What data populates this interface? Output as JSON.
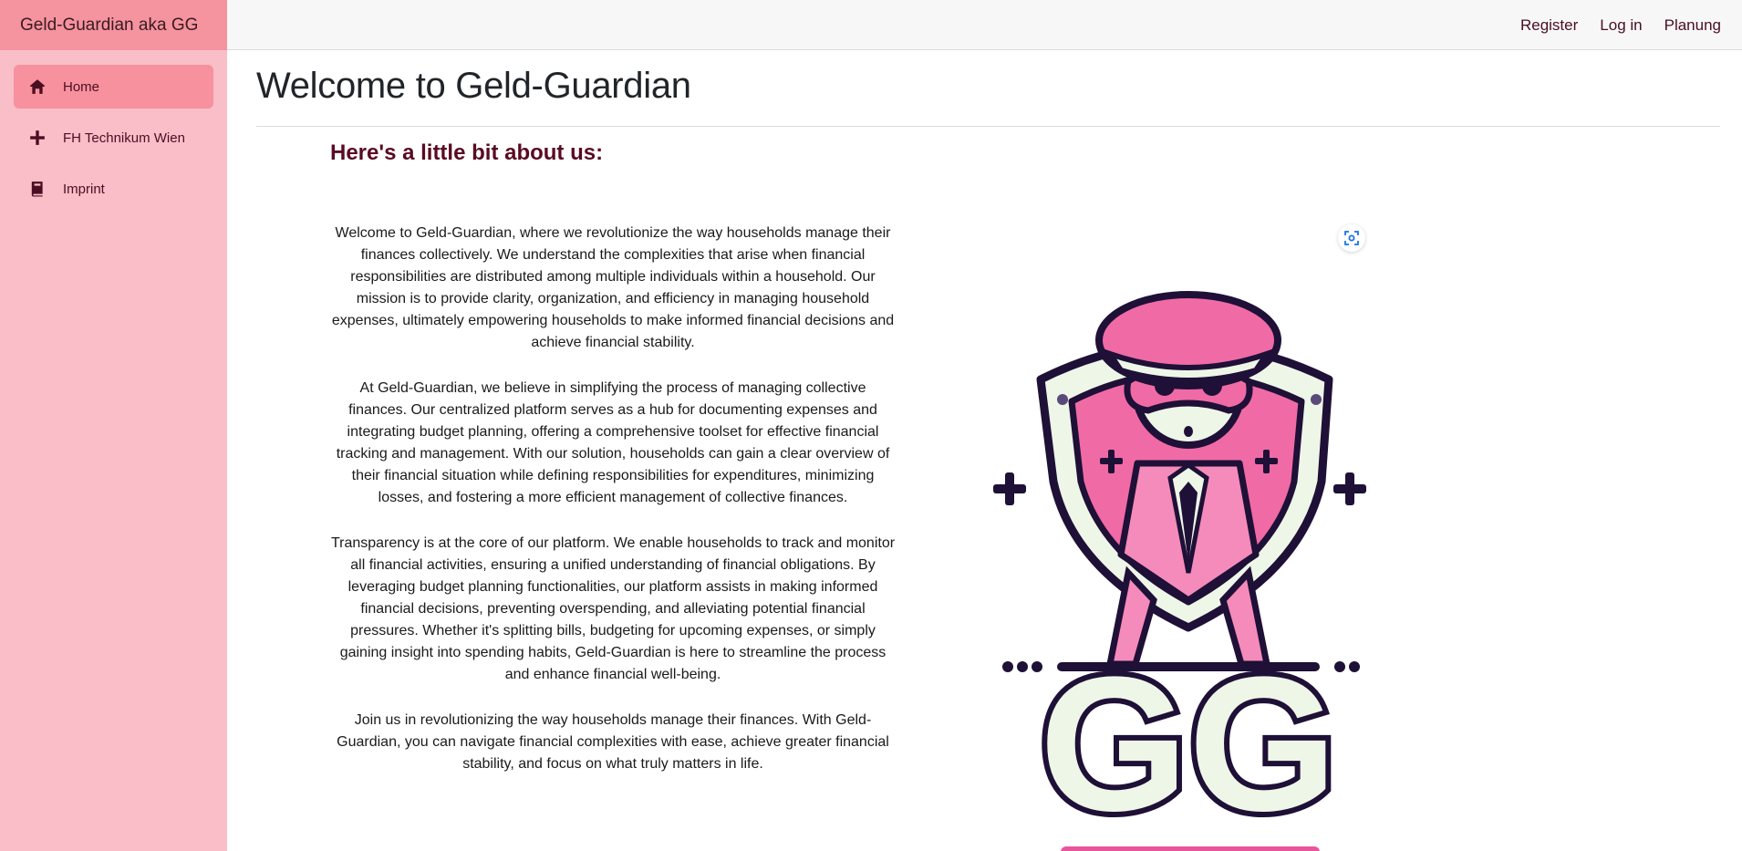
{
  "brand": {
    "title": "Geld-Guardian aka GG"
  },
  "sidebar": {
    "items": [
      {
        "label": "Home",
        "icon": "home-icon",
        "active": true
      },
      {
        "label": "FH Technikum Wien",
        "icon": "plus-icon",
        "active": false
      },
      {
        "label": "Imprint",
        "icon": "book-icon",
        "active": false
      }
    ]
  },
  "topnav": {
    "register": "Register",
    "login": "Log in",
    "planung": "Planung"
  },
  "main": {
    "title": "Welcome to Geld-Guardian",
    "subheading": "Here's a little bit about us:",
    "paragraphs": [
      "Welcome to Geld-Guardian, where we revolutionize the way households manage their finances collectively. We understand the complexities that arise when financial responsibilities are distributed among multiple individuals within a household. Our mission is to provide clarity, organization, and efficiency in managing household expenses, ultimately empowering households to make informed financial decisions and achieve financial stability.",
      "At Geld-Guardian, we believe in simplifying the process of managing collective finances. Our centralized platform serves as a hub for documenting expenses and integrating budget planning, offering a comprehensive toolset for effective financial tracking and management. With our solution, households can gain a clear overview of their financial situation while defining responsibilities for expenditures, minimizing losses, and fostering a more efficient management of collective finances.",
      "Transparency is at the core of our platform. We enable households to track and monitor all financial activities, ensuring a unified understanding of financial obligations. By leveraging budget planning functionalities, our platform assists in making informed financial decisions, preventing overspending, and alleviating potential financial pressures. Whether it's splitting bills, budgeting for upcoming expenses, or simply gaining insight into spending habits, Geld-Guardian is here to streamline the process and enhance financial well-being.",
      "Join us in revolutionizing the way households manage their finances. With Geld-Guardian, you can navigate financial complexities with ease, achieve greater financial stability, and focus on what truly matters in life."
    ],
    "logo_text": "GG"
  },
  "colors": {
    "sidebar_bg": "#f9bec8",
    "brand_bg": "#f5939f",
    "active_item": "#f7919e",
    "accent_text": "#4a0e22",
    "logo_pink": "#f06aa6",
    "logo_dark": "#1e1036"
  }
}
